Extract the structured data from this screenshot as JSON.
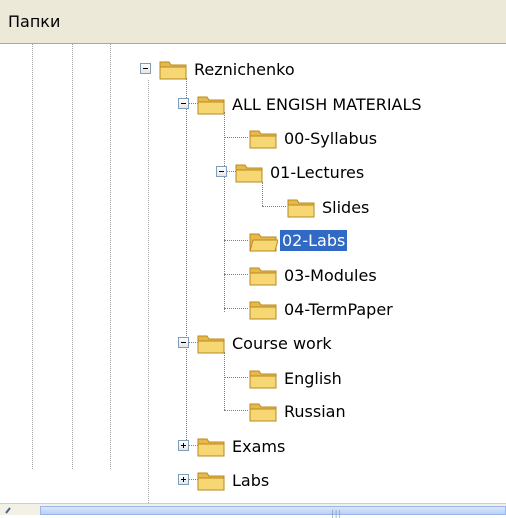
{
  "panel": {
    "title": "Папки"
  },
  "tree": {
    "root_label": "Reznichenko",
    "items": [
      {
        "label": "ALL ENGISH MATERIALS"
      },
      {
        "label": "00-Syllabus"
      },
      {
        "label": "01-Lectures"
      },
      {
        "label": "Slides"
      },
      {
        "label": "02-Labs"
      },
      {
        "label": "03-Modules"
      },
      {
        "label": "04-TermPaper"
      },
      {
        "label": "Course work"
      },
      {
        "label": "English"
      },
      {
        "label": "Russian"
      },
      {
        "label": "Exams"
      },
      {
        "label": "Labs"
      }
    ],
    "selected_label": "02-Labs"
  },
  "colors": {
    "selection": "#316ac5",
    "header_bg": "#ece9d8",
    "folder": "#f7d774"
  },
  "icons": {
    "folder": "folder-icon",
    "expand": "plus-box-icon",
    "collapse": "minus-box-icon"
  }
}
